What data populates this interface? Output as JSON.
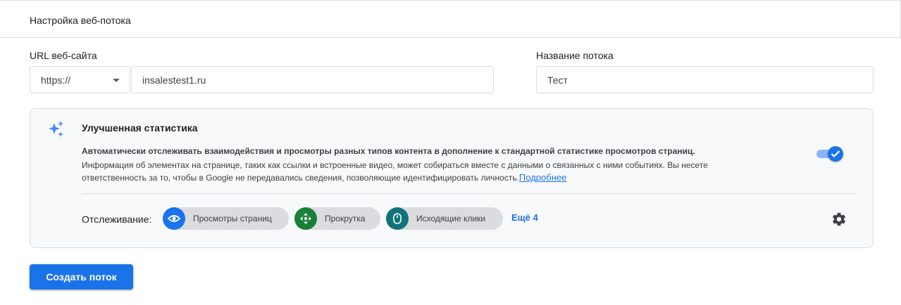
{
  "header": {
    "title": "Настройка веб-потока"
  },
  "url_section": {
    "label": "URL веб-сайта",
    "protocol": "https://",
    "domain": "insalestest1.ru"
  },
  "stream_section": {
    "label": "Название потока",
    "value": "Тест"
  },
  "enhanced": {
    "icon": "sparkle-icon",
    "title": "Улучшенная статистика",
    "description_bold": "Автоматически отслеживать взаимодействия и просмотры разных типов контента в дополнение к стандартной статистике просмотров страниц.",
    "description": "Информация об элементах на странице, таких как ссылки и встроенные видео, может собираться вместе с данными о связанных с ними событиях. Вы несете ответственность за то, чтобы в Google не передавались сведения, позволяющие идентифицировать личность.",
    "learn_more": "Подробнее",
    "toggle_on": true,
    "tracking_label": "Отслеживание:",
    "chips": [
      {
        "label": "Просмотры страниц",
        "icon": "eye-icon",
        "color": "#1a73e8"
      },
      {
        "label": "Прокрутка",
        "icon": "scroll-arrows-icon",
        "color": "#188038"
      },
      {
        "label": "Исходящие клики",
        "icon": "mouse-icon",
        "color": "#12737a"
      }
    ],
    "more_label": "Ещё 4"
  },
  "create_button": "Создать поток",
  "colors": {
    "accent": "#1a73e8",
    "green": "#188038",
    "teal": "#12737a"
  }
}
